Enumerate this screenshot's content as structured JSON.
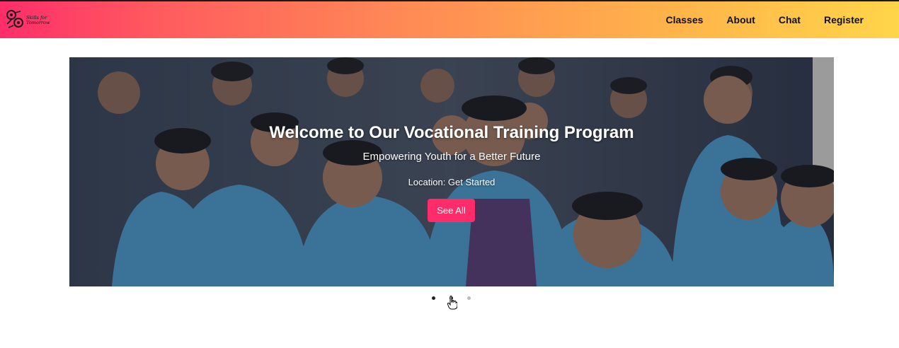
{
  "brand": {
    "logo_text": "Skills for Tomorrow",
    "logo_icon": "gear-cog-icon"
  },
  "nav": {
    "items": [
      {
        "label": "Classes"
      },
      {
        "label": "About"
      },
      {
        "label": "Chat"
      },
      {
        "label": "Register"
      }
    ]
  },
  "hero": {
    "title": "Welcome to Our Vocational Training Program",
    "subtitle": "Empowering Youth for a Better Future",
    "location": "Location: Get Started",
    "button_label": "See All",
    "image": "students-classroom-photo"
  },
  "carousel": {
    "slide_count": 3,
    "active_index": 1
  },
  "colors": {
    "nav_gradient_start": "#ff2d6a",
    "nav_gradient_end": "#ffd54a",
    "cta": "#ff2c69",
    "dot_active": "#222222",
    "dot_inactive": "#bbbbbb"
  },
  "cursor": "hand-pointer-icon"
}
